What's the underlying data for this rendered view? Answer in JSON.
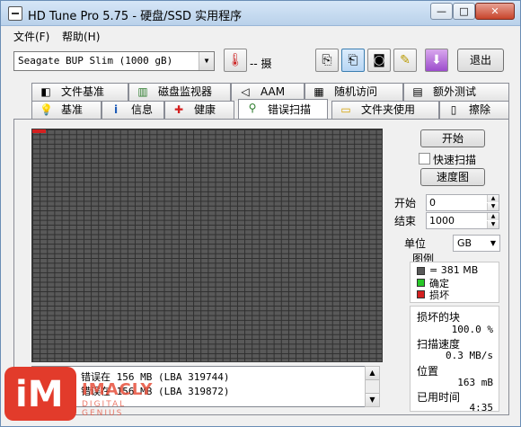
{
  "window": {
    "title": "HD Tune Pro 5.75 - 硬盘/SSD 实用程序",
    "controls": {
      "minimize": "—",
      "maximize": "□",
      "close": "✕"
    }
  },
  "menu": {
    "items": [
      "文件(F)",
      "帮助(H)"
    ]
  },
  "toolbar": {
    "drive": "Seagate BUP Slim (1000 gB)",
    "temperature": "-- 摄",
    "exit_label": "退出"
  },
  "tabs": {
    "row1": [
      {
        "label": "文件基准",
        "icon": "hdd-benchmark-icon"
      },
      {
        "label": "磁盘监视器",
        "icon": "chart-icon"
      },
      {
        "label": "AAM",
        "icon": "speaker-icon"
      },
      {
        "label": "随机访问",
        "icon": "random-icon"
      },
      {
        "label": "额外测试",
        "icon": "extra-icon"
      }
    ],
    "row2": [
      {
        "label": "基准",
        "icon": "bulb-icon"
      },
      {
        "label": "信息",
        "icon": "info-icon"
      },
      {
        "label": "健康",
        "icon": "health-icon"
      },
      {
        "label": "错误扫描",
        "icon": "magnifier-icon",
        "active": true
      },
      {
        "label": "文件夹使用",
        "icon": "folder-icon"
      },
      {
        "label": "擦除",
        "icon": "trash-icon"
      }
    ]
  },
  "scan": {
    "start_button": "开始",
    "quick_scan_label": "快速扫描",
    "quick_scan_checked": false,
    "speed_map_button": "速度图",
    "start_label": "开始",
    "start_value": "0",
    "end_label": "结束",
    "end_value": "1000",
    "unit_label": "单位",
    "unit_value": "GB",
    "legend_title": "图例",
    "legend": [
      {
        "label": "= 381 MB",
        "color": "#595959"
      },
      {
        "label": "确定",
        "color": "#28c828"
      },
      {
        "label": "损坏",
        "color": "#d42020"
      }
    ],
    "stats": {
      "damaged_label": "损坏的块",
      "damaged_value": "100.0 %",
      "speed_label": "扫描速度",
      "speed_value": "0.3 MB/s",
      "position_label": "位置",
      "position_value": "163 mB",
      "elapsed_label": "已用时间",
      "elapsed_value": "4:35"
    },
    "log": [
      "错误在 156 MB (LBA 319744)",
      "错误在 156 MB (LBA 319872)"
    ]
  },
  "watermark": {
    "logo_text": "iM",
    "brand": "IMACLY",
    "tagline": "DIGITAL GENIUS"
  }
}
